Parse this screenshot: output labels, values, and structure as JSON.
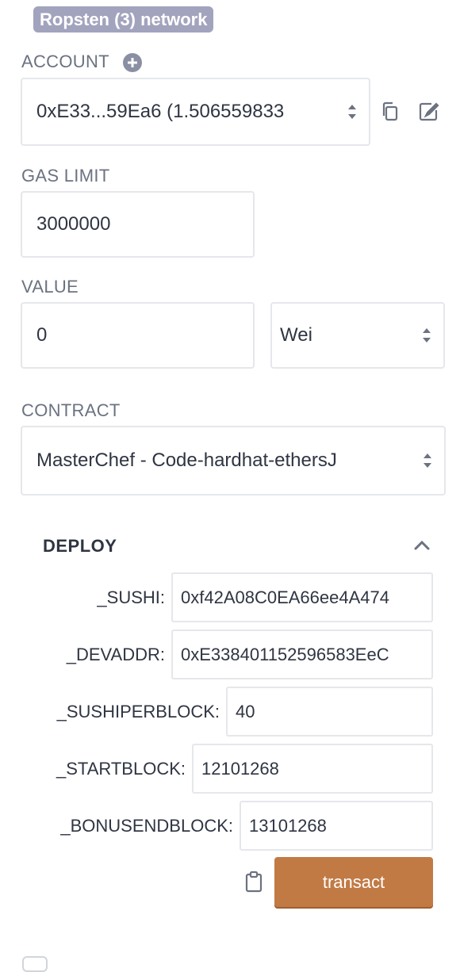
{
  "network": {
    "label": "Ropsten (3) network"
  },
  "account": {
    "label": "ACCOUNT",
    "value": "0xE33...59Ea6 (1.506559833"
  },
  "gas_limit": {
    "label": "GAS LIMIT",
    "value": "3000000"
  },
  "value_field": {
    "label": "VALUE",
    "amount": "0",
    "unit": "Wei"
  },
  "contract": {
    "label": "CONTRACT",
    "value": "MasterChef - Code-hardhat-ethersJ"
  },
  "deploy": {
    "title": "DEPLOY",
    "params": [
      {
        "label": "_SUSHI:",
        "value": "0xf42A08C0EA66ee4A474"
      },
      {
        "label": "_DEVADDR:",
        "value": "0xE338401152596583EeC"
      },
      {
        "label": "_SUSHIPERBLOCK:",
        "value": "40"
      },
      {
        "label": "_STARTBLOCK:",
        "value": "12101268"
      },
      {
        "label": "_BONUSENDBLOCK:",
        "value": "13101268"
      }
    ],
    "transact_label": "transact"
  },
  "icons": {
    "add_account": "plus-circle-icon",
    "copy": "copy-icon",
    "edit": "edit-icon",
    "collapse": "chevron-up-icon",
    "clipboard": "clipboard-icon"
  },
  "colors": {
    "badge": "#a2a3bd",
    "transact": "#c27a45",
    "label": "#6b7280",
    "text": "#2f3542"
  }
}
